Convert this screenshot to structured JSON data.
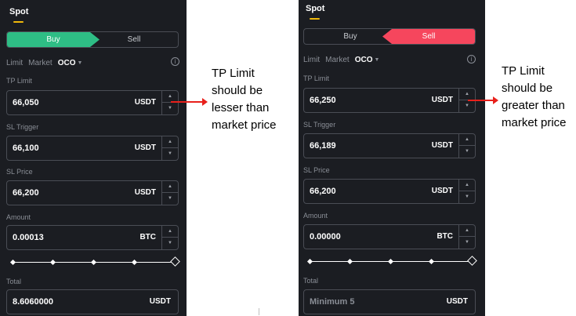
{
  "left": {
    "tab": "Spot",
    "buy_label": "Buy",
    "sell_label": "Sell",
    "active_side": "buy",
    "order_types": [
      "Limit",
      "Market",
      "OCO"
    ],
    "fields": [
      {
        "label": "TP Limit",
        "value": "66,050",
        "unit": "USDT"
      },
      {
        "label": "SL Trigger",
        "value": "66,100",
        "unit": "USDT"
      },
      {
        "label": "SL Price",
        "value": "66,200",
        "unit": "USDT"
      },
      {
        "label": "Amount",
        "value": "0.00013",
        "unit": "BTC"
      },
      {
        "label": "Total",
        "value": "8.6060000",
        "unit": "USDT"
      }
    ]
  },
  "right": {
    "tab": "Spot",
    "buy_label": "Buy",
    "sell_label": "Sell",
    "active_side": "sell",
    "order_types": [
      "Limit",
      "Market",
      "OCO"
    ],
    "fields": [
      {
        "label": "TP Limit",
        "value": "66,250",
        "unit": "USDT"
      },
      {
        "label": "SL Trigger",
        "value": "66,189",
        "unit": "USDT"
      },
      {
        "label": "SL Price",
        "value": "66,200",
        "unit": "USDT"
      },
      {
        "label": "Amount",
        "value": "0.00000",
        "unit": "BTC"
      },
      {
        "label": "Total",
        "placeholder": "Minimum 5",
        "unit": "USDT"
      }
    ]
  },
  "annotations": {
    "left": [
      "TP Limit",
      "should be",
      "lesser than",
      "market price"
    ],
    "right": [
      "TP Limit",
      "should be",
      "greater than",
      "market price"
    ]
  },
  "colors": {
    "panel_bg": "#1b1d22",
    "buy_green": "#2ebd85",
    "sell_red": "#f6465d",
    "tab_accent": "#f0b90b",
    "arrow_red": "#e8201b"
  },
  "icons": [
    "chevron-down-icon",
    "info-icon",
    "increment-icon",
    "decrement-icon"
  ]
}
